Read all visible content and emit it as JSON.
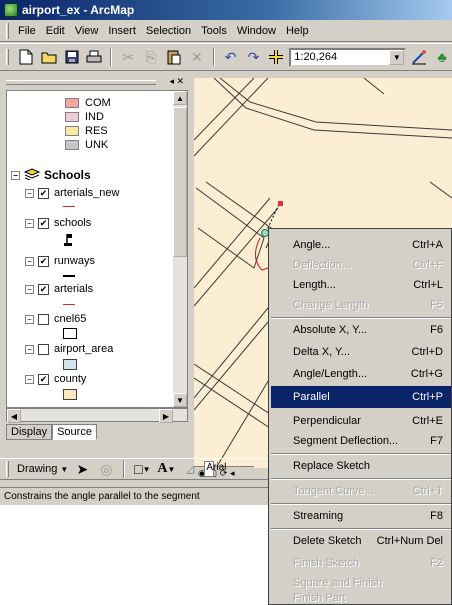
{
  "window": {
    "title": "airport_ex - ArcMap"
  },
  "menubar": {
    "items": [
      "File",
      "Edit",
      "View",
      "Insert",
      "Selection",
      "Tools",
      "Window",
      "Help"
    ]
  },
  "toolbar": {
    "scale_value": "1:20,264"
  },
  "toc": {
    "legend": [
      {
        "label": "COM",
        "color": "#f4a7a0"
      },
      {
        "label": "IND",
        "color": "#f0c8dc"
      },
      {
        "label": "RES",
        "color": "#f4ec9c"
      },
      {
        "label": "UNK",
        "color": "#c8c8c8"
      }
    ],
    "group": "Schools",
    "layers": [
      {
        "label": "arterials_new",
        "checked": true
      },
      {
        "label": "schools",
        "checked": true
      },
      {
        "label": "runways",
        "checked": true
      },
      {
        "label": "arterials",
        "checked": true
      },
      {
        "label": "cnel65",
        "checked": false
      },
      {
        "label": "airport_area",
        "checked": false
      },
      {
        "label": "county",
        "checked": true
      }
    ],
    "tabs": {
      "display": "Display",
      "source": "Source"
    }
  },
  "drawbar": {
    "drawing_label": "Drawing",
    "font_value": "Arial"
  },
  "statusbar": {
    "text": "Constrains the angle parallel to the segment"
  },
  "context_menu": {
    "items": [
      {
        "label": "Angle...",
        "shortcut": "Ctrl+A",
        "disabled": false,
        "selected": false
      },
      {
        "label": "Deflection...",
        "shortcut": "Ctrl+F",
        "disabled": true,
        "selected": false
      },
      {
        "label": "Length...",
        "shortcut": "Ctrl+L",
        "disabled": false,
        "selected": false
      },
      {
        "label": "Change Length",
        "shortcut": "F5",
        "disabled": true,
        "selected": false
      },
      {
        "label": "Absolute X, Y...",
        "shortcut": "F6",
        "disabled": false,
        "selected": false
      },
      {
        "label": "Delta X, Y...",
        "shortcut": "Ctrl+D",
        "disabled": false,
        "selected": false
      },
      {
        "label": "Angle/Length...",
        "shortcut": "Ctrl+G",
        "disabled": false,
        "selected": false
      },
      {
        "label": "Parallel",
        "shortcut": "Ctrl+P",
        "disabled": false,
        "selected": true
      },
      {
        "label": "Perpendicular",
        "shortcut": "Ctrl+E",
        "disabled": false,
        "selected": false
      },
      {
        "label": "Segment Deflection...",
        "shortcut": "F7",
        "disabled": false,
        "selected": false
      },
      {
        "label": "Replace Sketch",
        "shortcut": "",
        "disabled": false,
        "selected": false
      },
      {
        "label": "Tangent Curve...",
        "shortcut": "Ctrl+T",
        "disabled": true,
        "selected": false
      },
      {
        "label": "Streaming",
        "shortcut": "F8",
        "disabled": false,
        "selected": false
      },
      {
        "label": "Delete Sketch",
        "shortcut": "Ctrl+Num Del",
        "disabled": false,
        "selected": false
      },
      {
        "label": "Finish Sketch",
        "shortcut": "F2",
        "disabled": true,
        "selected": false
      },
      {
        "label": "Square and Finish",
        "shortcut": "",
        "disabled": true,
        "selected": false
      },
      {
        "label": "Finish Part",
        "shortcut": "",
        "disabled": true,
        "selected": false
      }
    ]
  }
}
